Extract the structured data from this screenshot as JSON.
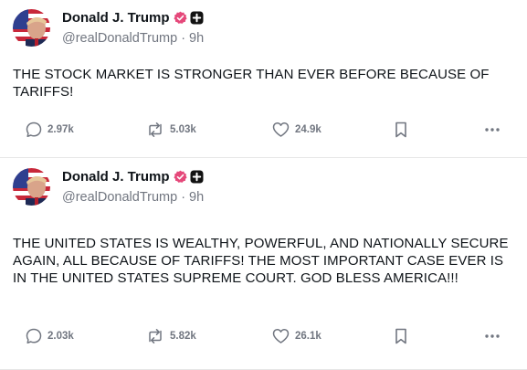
{
  "posts": [
    {
      "author": {
        "display_name": "Donald J. Trump",
        "handle": "@realDonaldTrump",
        "separator": "·",
        "time": "9h",
        "verified_icon": "verified-badge-icon",
        "badge_icon": "plus-badge-icon"
      },
      "text": "THE STOCK MARKET IS STRONGER THAN EVER BEFORE BECAUSE OF TARIFFS!",
      "stats": {
        "replies": "2.97k",
        "reposts": "5.03k",
        "likes": "24.9k"
      }
    },
    {
      "author": {
        "display_name": "Donald J. Trump",
        "handle": "@realDonaldTrump",
        "separator": "·",
        "time": "9h",
        "verified_icon": "verified-badge-icon",
        "badge_icon": "plus-badge-icon"
      },
      "text": "THE UNITED STATES IS WEALTHY, POWERFUL, AND NATIONALLY SECURE AGAIN, ALL BECAUSE OF TARIFFS! THE MOST IMPORTANT CASE EVER IS IN THE UNITED STATES SUPREME COURT. GOD BLESS AMERICA!!!",
      "stats": {
        "replies": "2.03k",
        "reposts": "5.82k",
        "likes": "26.1k"
      }
    }
  ],
  "colors": {
    "text_primary": "#0f1419",
    "text_secondary": "#717680",
    "verified": "#e5487a",
    "divider": "#e6e6e6"
  },
  "icons": {
    "reply": "speech-bubble-icon",
    "repost": "repost-arrows-icon",
    "like": "heart-icon",
    "bookmark": "bookmark-icon",
    "more": "more-dots-icon"
  }
}
